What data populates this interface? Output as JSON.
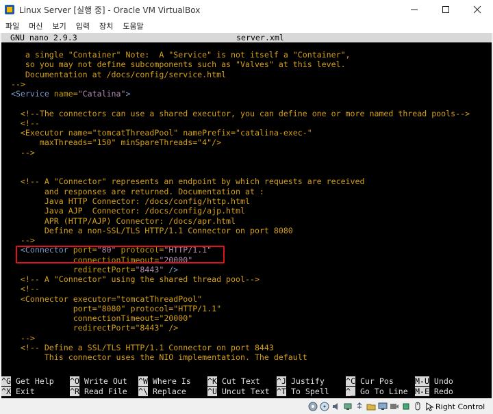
{
  "window": {
    "title": "Linux Server [실행 중] - Oracle VM VirtualBox"
  },
  "menu": [
    "파일",
    "머신",
    "보기",
    "입력",
    "장치",
    "도움말"
  ],
  "nano": {
    "version": "GNU nano 2.9.3",
    "filename": "server.xml"
  },
  "editor_lines": [
    [
      [
        "c",
        "     a single \"Container\" Note:  A \"Service\" is not itself a \"Container\","
      ]
    ],
    [
      [
        "c",
        "     so you may not define subcomponents such as \"Valves\" at this level."
      ]
    ],
    [
      [
        "c",
        "     Documentation at /docs/config/service.html"
      ]
    ],
    [
      [
        "c",
        "  -->"
      ]
    ],
    [
      [
        "t",
        "  <Service "
      ],
      [
        "a",
        "name="
      ],
      [
        "v",
        "\"Catalina\""
      ],
      [
        "t",
        ">"
      ]
    ],
    [
      [
        "c",
        ""
      ]
    ],
    [
      [
        "c",
        "    <!--The connectors can use a shared executor, you can define one or more named thread pools-->"
      ]
    ],
    [
      [
        "c",
        "    <!--"
      ]
    ],
    [
      [
        "c",
        "    <Executor name=\"tomcatThreadPool\" namePrefix=\"catalina-exec-\""
      ]
    ],
    [
      [
        "c",
        "        maxThreads=\"150\" minSpareThreads=\"4\"/>"
      ]
    ],
    [
      [
        "c",
        "    -->"
      ]
    ],
    [
      [
        "c",
        ""
      ]
    ],
    [
      [
        "c",
        ""
      ]
    ],
    [
      [
        "c",
        "    <!-- A \"Connector\" represents an endpoint by which requests are received"
      ]
    ],
    [
      [
        "c",
        "         and responses are returned. Documentation at :"
      ]
    ],
    [
      [
        "c",
        "         Java HTTP Connector: /docs/config/http.html"
      ]
    ],
    [
      [
        "c",
        "         Java AJP  Connector: /docs/config/ajp.html"
      ]
    ],
    [
      [
        "c",
        "         APR (HTTP/AJP) Connector: /docs/apr.html"
      ]
    ],
    [
      [
        "c",
        "         Define a non-SSL/TLS HTTP/1.1 Connector on port 8080"
      ]
    ],
    [
      [
        "c",
        "    -->"
      ]
    ],
    [
      [
        "t",
        "    <Connector "
      ],
      [
        "a",
        "port="
      ],
      [
        "v",
        "\"80\""
      ],
      [
        "a",
        " protocol="
      ],
      [
        "v",
        "\"HTTP/1.1\""
      ]
    ],
    [
      [
        "a",
        "               connectionTimeout="
      ],
      [
        "v",
        "\"20000\""
      ]
    ],
    [
      [
        "a",
        "               redirectPort="
      ],
      [
        "v",
        "\"8443\""
      ],
      [
        "t",
        " />"
      ]
    ],
    [
      [
        "c",
        "    <!-- A \"Connector\" using the shared thread pool-->"
      ]
    ],
    [
      [
        "c",
        "    <!--"
      ]
    ],
    [
      [
        "c",
        "    <Connector executor=\"tomcatThreadPool\""
      ]
    ],
    [
      [
        "c",
        "               port=\"8080\" protocol=\"HTTP/1.1\""
      ]
    ],
    [
      [
        "c",
        "               connectionTimeout=\"20000\""
      ]
    ],
    [
      [
        "c",
        "               redirectPort=\"8443\" />"
      ]
    ],
    [
      [
        "c",
        "    -->"
      ]
    ],
    [
      [
        "c",
        "    <!-- Define a SSL/TLS HTTP/1.1 Connector on port 8443"
      ]
    ],
    [
      [
        "c",
        "         This connector uses the NIO implementation. The default"
      ]
    ]
  ],
  "shortcuts": [
    [
      {
        "k": "^G",
        "l": " Get Help"
      },
      {
        "k": "^O",
        "l": " Write Out"
      },
      {
        "k": "^W",
        "l": " Where Is"
      },
      {
        "k": "^K",
        "l": " Cut Text"
      },
      {
        "k": "^J",
        "l": " Justify"
      },
      {
        "k": "^C",
        "l": " Cur Pos"
      },
      {
        "k": "M-U",
        "l": " Undo"
      }
    ],
    [
      {
        "k": "^X",
        "l": " Exit"
      },
      {
        "k": "^R",
        "l": " Read File"
      },
      {
        "k": "^\\",
        "l": " Replace"
      },
      {
        "k": "^U",
        "l": " Uncut Text"
      },
      {
        "k": "^T",
        "l": " To Spell"
      },
      {
        "k": "^_",
        "l": " Go To Line"
      },
      {
        "k": "M-E",
        "l": " Redo"
      }
    ]
  ],
  "status": {
    "host_key": "Right Control"
  },
  "colors": {
    "comment": "#d4a017",
    "tag": "#7a9ccc",
    "attribute": "#c4a000",
    "value": "#b28eb2",
    "highlight": "#e1141c"
  }
}
